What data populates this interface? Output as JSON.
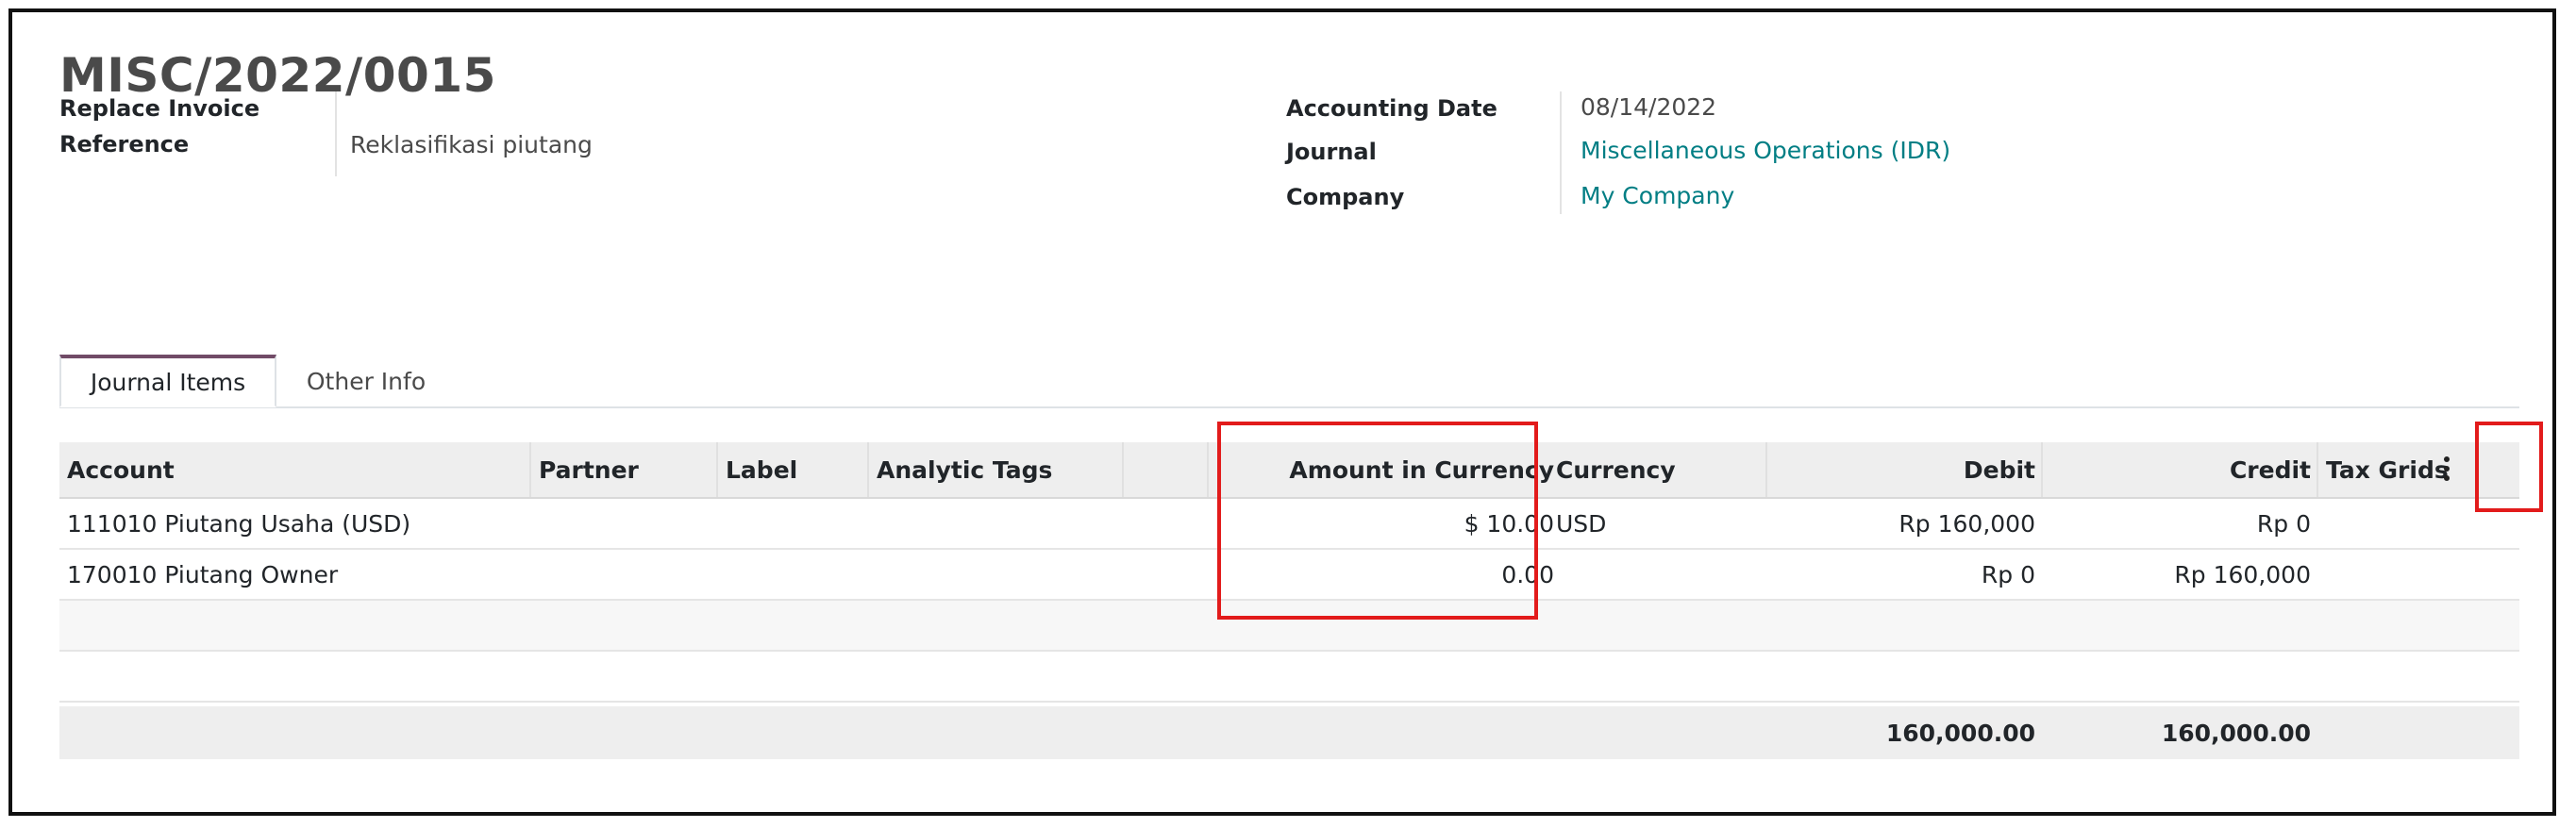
{
  "record": {
    "title": "MISC/2022/0015"
  },
  "fields": {
    "replace_invoice_label": "Replace Invoice",
    "reference_label": "Reference",
    "reference_value": "Reklasifikasi piutang",
    "accounting_date_label": "Accounting Date",
    "accounting_date_value": "08/14/2022",
    "journal_label": "Journal",
    "journal_value": "Miscellaneous Operations (IDR)",
    "company_label": "Company",
    "company_value": "My Company"
  },
  "tabs": [
    {
      "label": "Journal Items",
      "active": true
    },
    {
      "label": "Other Info",
      "active": false
    }
  ],
  "table": {
    "columns": {
      "account": "Account",
      "partner": "Partner",
      "label": "Label",
      "analytic_tags": "Analytic Tags",
      "amount_currency": "Amount in Currency",
      "currency": "Currency",
      "debit": "Debit",
      "credit": "Credit",
      "tax_grids": "Tax Grids"
    },
    "rows": [
      {
        "account": "111010 Piutang Usaha (USD)",
        "partner": "",
        "label": "",
        "analytic_tags": "",
        "amount_currency": "$ 10.00",
        "currency": "USD",
        "debit": "Rp 160,000",
        "credit": "Rp 0",
        "tax_grids": ""
      },
      {
        "account": "170010 Piutang Owner",
        "partner": "",
        "label": "",
        "analytic_tags": "",
        "amount_currency": "0.00",
        "currency": "",
        "debit": "Rp 0",
        "credit": "Rp 160,000",
        "tax_grids": ""
      }
    ],
    "totals": {
      "debit": "160,000.00",
      "credit": "160,000.00"
    }
  },
  "icons": {
    "optional_columns": "kebab-vertical-icon"
  },
  "colors": {
    "link": "#017e84",
    "tab_accent": "#714b67",
    "highlight": "#e21b1b"
  }
}
